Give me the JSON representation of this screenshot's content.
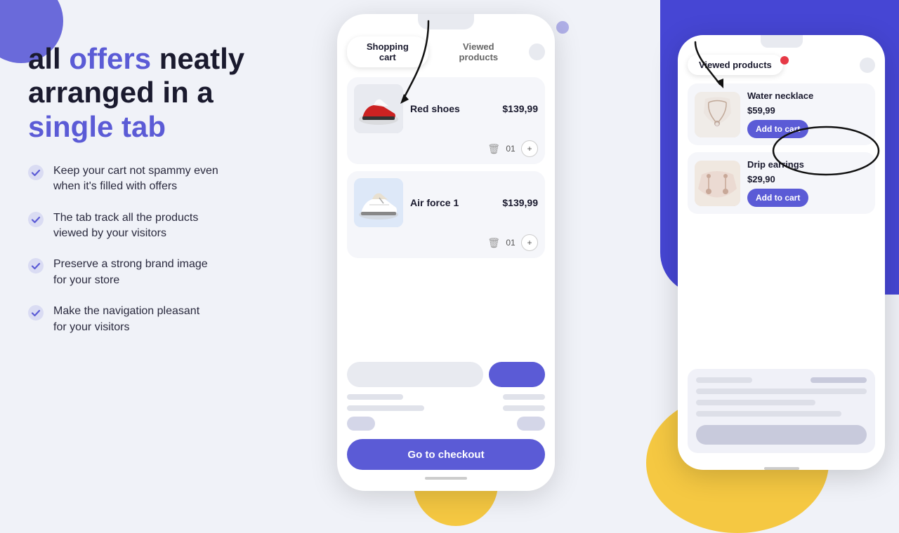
{
  "background": {
    "color": "#f0f2f8"
  },
  "headline": {
    "part1": "all ",
    "part2": "offers",
    "part3": " neatly\narranged in a\n",
    "part4": "single tab"
  },
  "features": [
    {
      "id": "feature-1",
      "text": "Keep your cart not spammy even\nwhen it's filled with offers"
    },
    {
      "id": "feature-2",
      "text": "The tab track all the products\nviewed by your visitors"
    },
    {
      "id": "feature-3",
      "text": "Preserve a strong brand image\nfor your store"
    },
    {
      "id": "feature-4",
      "text": "Make the navigation pleasant\nfor your visitors"
    }
  ],
  "phone1": {
    "tabs": {
      "tab1": "Shopping cart",
      "tab2": "Viewed products"
    },
    "products": [
      {
        "name": "Red shoes",
        "price": "$139,99",
        "qty": "01"
      },
      {
        "name": "Air force 1",
        "price": "$139,99",
        "qty": "01"
      }
    ],
    "checkout_btn": "Go to checkout"
  },
  "phone2": {
    "tab": "Viewed products",
    "products": [
      {
        "name": "Water necklace",
        "price": "$59,99",
        "btn": "Add to cart"
      },
      {
        "name": "Drip earrings",
        "price": "$29,90",
        "btn": "Add to cart"
      }
    ]
  }
}
